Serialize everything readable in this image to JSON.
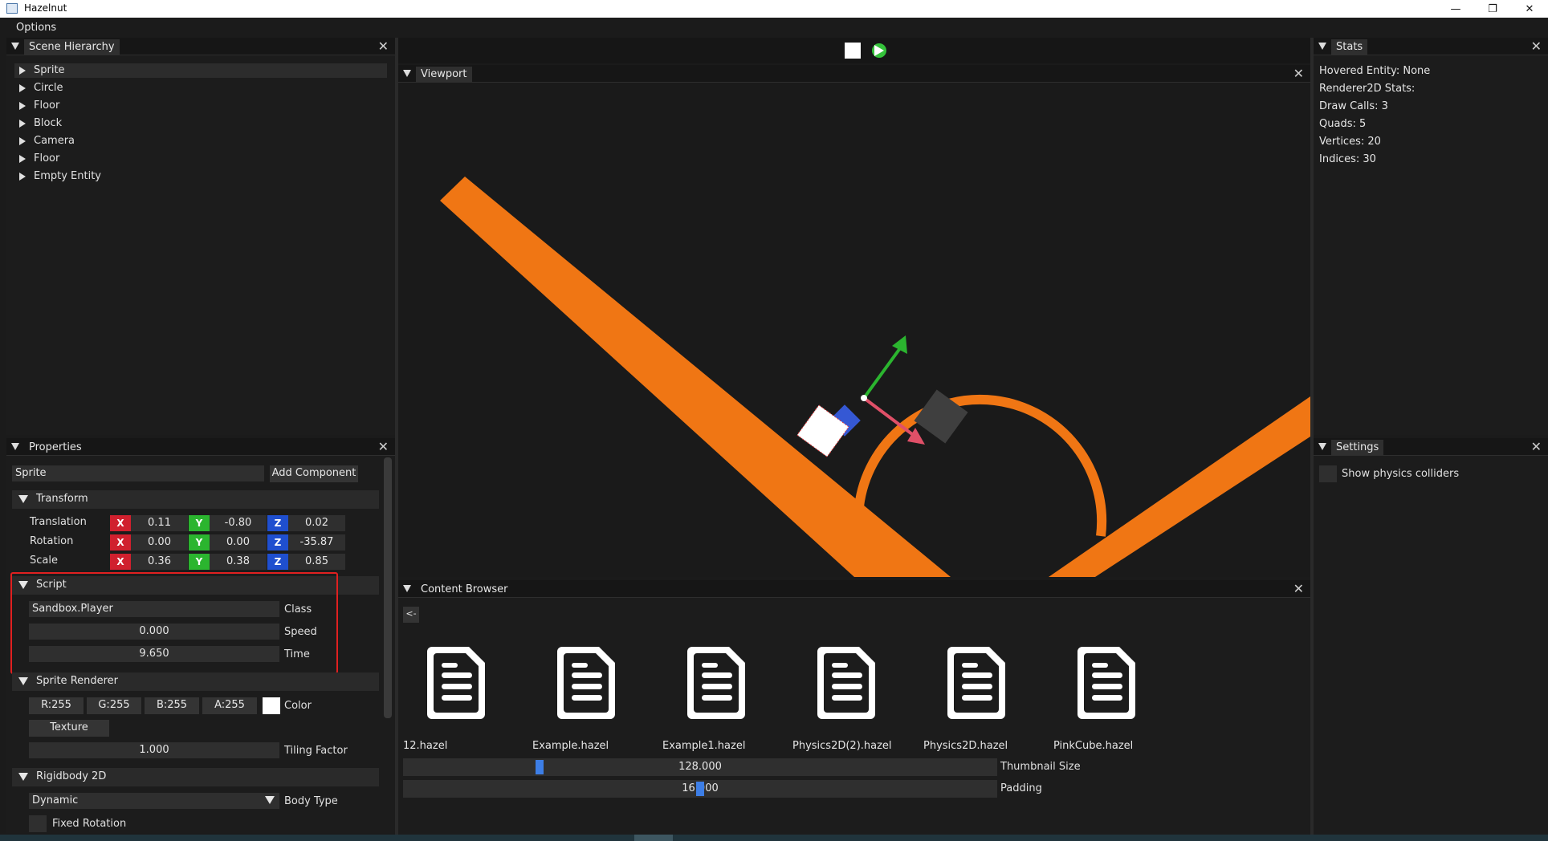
{
  "window": {
    "title": "Hazelnut",
    "minimize": "—",
    "restore": "❐",
    "close": "✕"
  },
  "menu": {
    "options": "Options"
  },
  "scene_hierarchy": {
    "title": "Scene Hierarchy",
    "items": [
      {
        "label": "Sprite",
        "selected": true
      },
      {
        "label": "Circle"
      },
      {
        "label": "Floor"
      },
      {
        "label": "Block"
      },
      {
        "label": "Camera"
      },
      {
        "label": "Floor"
      },
      {
        "label": "Empty Entity"
      }
    ]
  },
  "properties": {
    "title": "Properties",
    "entity_name": "Sprite",
    "add_component": "Add Component",
    "transform": {
      "title": "Transform",
      "translation": {
        "label": "Translation",
        "x": "0.11",
        "y": "-0.80",
        "z": "0.02"
      },
      "rotation": {
        "label": "Rotation",
        "x": "0.00",
        "y": "0.00",
        "z": "-35.87"
      },
      "scale": {
        "label": "Scale",
        "x": "0.36",
        "y": "0.38",
        "z": "0.85"
      },
      "axis_x": "X",
      "axis_y": "Y",
      "axis_z": "Z"
    },
    "script": {
      "title": "Script",
      "class_value": "Sandbox.Player",
      "class_label": "Class",
      "speed_value": "0.000",
      "speed_label": "Speed",
      "time_value": "9.650",
      "time_label": "Time"
    },
    "sprite_renderer": {
      "title": "Sprite Renderer",
      "r": "R:255",
      "g": "G:255",
      "b": "B:255",
      "a": "A:255",
      "color_label": "Color",
      "texture": "Texture",
      "tiling_value": "1.000",
      "tiling_label": "Tiling Factor"
    },
    "rigidbody": {
      "title": "Rigidbody 2D",
      "body_type_value": "Dynamic",
      "body_type_label": "Body Type",
      "fixed_rotation_label": "Fixed Rotation"
    }
  },
  "viewport": {
    "title": "Viewport"
  },
  "content_browser": {
    "title": "Content Browser",
    "back": "<-",
    "files": [
      "12.hazel",
      "Example.hazel",
      "Example1.hazel",
      "Physics2D(2).hazel",
      "Physics2D.hazel",
      "PinkCube.hazel"
    ],
    "thumbnail_value": "128.000",
    "thumbnail_label": "Thumbnail Size",
    "padding_value": "16.000",
    "padding_label": "Padding"
  },
  "stats": {
    "title": "Stats",
    "hovered": "Hovered Entity: None",
    "renderer": "Renderer2D Stats:",
    "draw_calls": "Draw Calls: 3",
    "quads": "Quads: 5",
    "vertices": "Vertices: 20",
    "indices": "Indices: 30"
  },
  "settings": {
    "title": "Settings",
    "show_colliders": "Show physics colliders"
  },
  "colors": {
    "orange": "#f07614",
    "highlight": "#e02020",
    "accent": "#3d7ee6"
  }
}
